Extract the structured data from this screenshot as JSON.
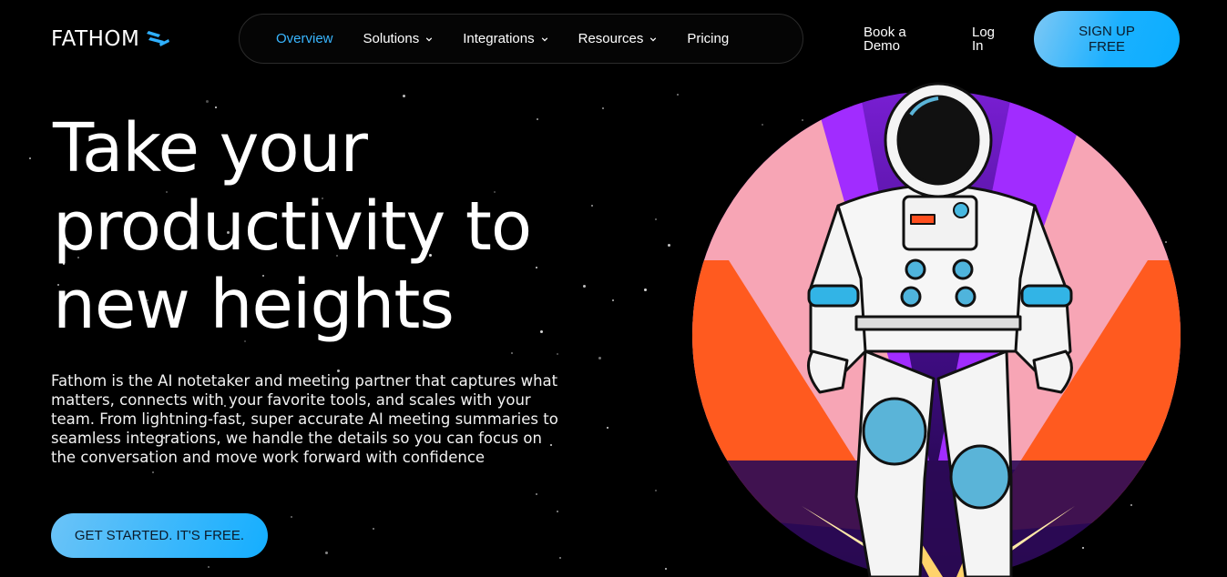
{
  "brand": {
    "name": "FATHOM",
    "accent": "#2fb0ff"
  },
  "nav": {
    "items": [
      {
        "label": "Overview",
        "active": true,
        "has_dropdown": false
      },
      {
        "label": "Solutions",
        "active": false,
        "has_dropdown": true
      },
      {
        "label": "Integrations",
        "active": false,
        "has_dropdown": true
      },
      {
        "label": "Resources",
        "active": false,
        "has_dropdown": true
      },
      {
        "label": "Pricing",
        "active": false,
        "has_dropdown": false
      }
    ]
  },
  "header": {
    "book_demo": "Book a Demo",
    "login": "Log In",
    "signup": "SIGN UP FREE"
  },
  "hero": {
    "title_lines": [
      "Take your",
      "productivity to",
      "new heights"
    ],
    "description": "Fathom is the AI notetaker and meeting partner that captures what matters, connects with your favorite tools, and scales with your team. From lightning-fast, super accurate AI meeting summaries to seamless integrations, we handle the details so you can focus on the conversation and move work forward with confidence",
    "cta": "GET STARTED. IT'S FREE."
  },
  "icons": {
    "logo": "fathom-logo-icon",
    "chevron": "chevron-down-icon",
    "illustration": "astronaut-illustration"
  }
}
